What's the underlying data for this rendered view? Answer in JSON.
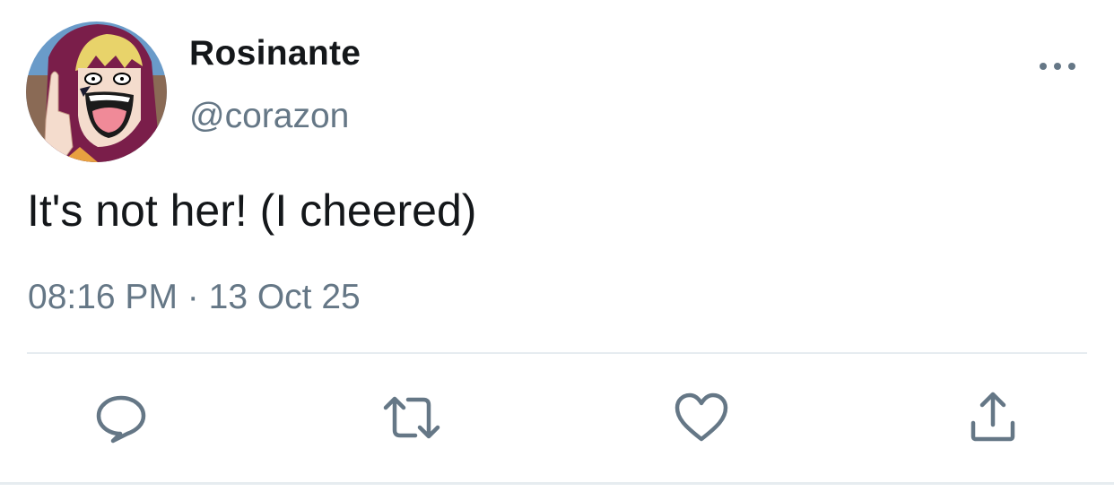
{
  "user": {
    "display_name": "Rosinante",
    "handle": "@corazon",
    "avatar_icon": "avatar-character-image"
  },
  "tweet": {
    "text": "It's not her! (I cheered)",
    "time": "08:16 PM",
    "separator": "·",
    "date": "13 Oct 25"
  },
  "actions": {
    "more": "more-options-icon",
    "reply": "reply-icon",
    "retweet": "retweet-icon",
    "like": "heart-icon",
    "share": "share-icon"
  },
  "colors": {
    "text_primary": "#14171a",
    "text_secondary": "#657786",
    "icon": "#657786",
    "divider": "#e6ecf0"
  }
}
